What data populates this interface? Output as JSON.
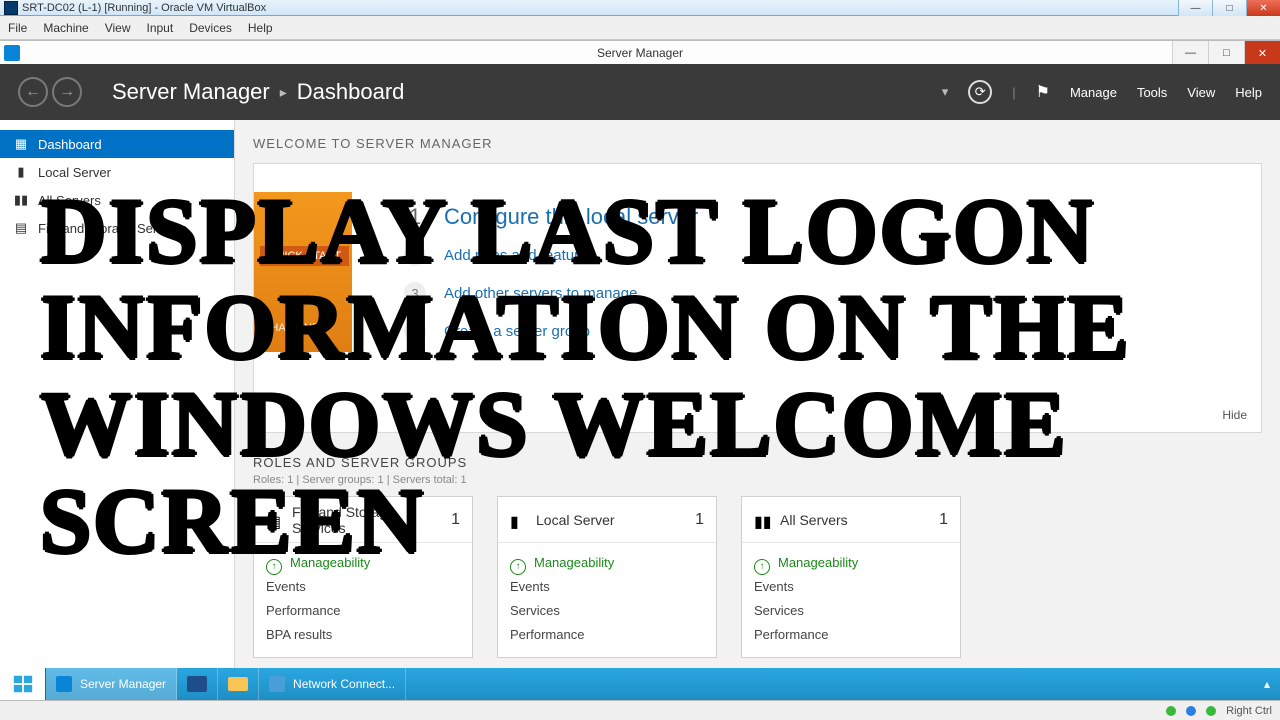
{
  "outer": {
    "title": "SRT-DC02 (L-1) [Running] - Oracle VM VirtualBox",
    "menu": [
      "File",
      "Machine",
      "View",
      "Input",
      "Devices",
      "Help"
    ]
  },
  "inner_title": "Server Manager",
  "header": {
    "crumb1": "Server Manager",
    "crumb2": "Dashboard",
    "menu": [
      "Manage",
      "Tools",
      "View",
      "Help"
    ]
  },
  "sidebar": {
    "items": [
      {
        "label": "Dashboard",
        "active": true
      },
      {
        "label": "Local Server",
        "active": false
      },
      {
        "label": "All Servers",
        "active": false
      },
      {
        "label": "File and Storage Services",
        "active": false
      }
    ]
  },
  "welcome": {
    "heading": "WELCOME TO SERVER MANAGER",
    "quick_start": "QUICK START",
    "whats_new": "WHAT'S NEW",
    "links": [
      {
        "n": "1",
        "label": "Configure this local server",
        "primary": true
      },
      {
        "n": "2",
        "label": "Add roles and features",
        "primary": false
      },
      {
        "n": "3",
        "label": "Add other servers to manage",
        "primary": false
      },
      {
        "n": "4",
        "label": "Create a server group",
        "primary": false
      }
    ],
    "hide": "Hide"
  },
  "groups": {
    "title": "ROLES AND SERVER GROUPS",
    "sub": "Roles: 1   |   Server groups: 1   |   Servers total: 1",
    "tiles": [
      {
        "name": "File and Storage Services",
        "count": "1",
        "rows": [
          "Manageability",
          "Events",
          "Performance",
          "BPA results"
        ]
      },
      {
        "name": "Local Server",
        "count": "1",
        "rows": [
          "Manageability",
          "Events",
          "Services",
          "Performance"
        ]
      },
      {
        "name": "All Servers",
        "count": "1",
        "rows": [
          "Manageability",
          "Events",
          "Services",
          "Performance"
        ]
      }
    ]
  },
  "taskbar": {
    "items": [
      {
        "label": "Server Manager",
        "active": true
      },
      {
        "label": "",
        "active": false
      },
      {
        "label": "",
        "active": false
      },
      {
        "label": "Network Connect...",
        "active": false
      }
    ],
    "right_ctrl": "Right Ctrl"
  },
  "overlay_text": "Display Last Logon Information on the Windows Welcome Screen"
}
